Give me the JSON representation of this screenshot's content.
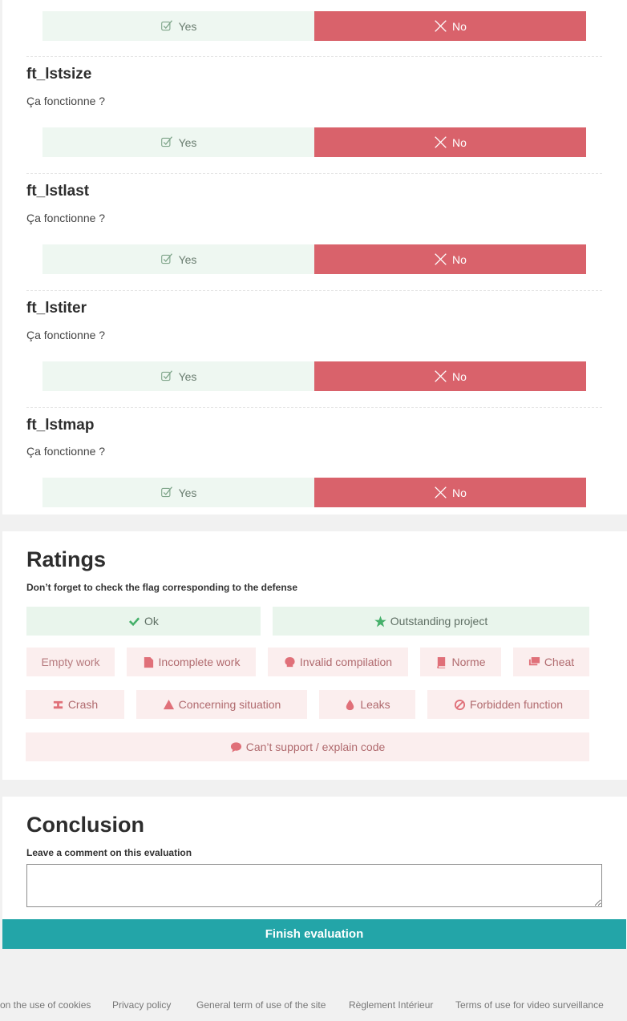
{
  "questions": [
    {
      "title": "",
      "subtitle": "",
      "yes_label": "Yes",
      "no_label": "No"
    },
    {
      "title": "ft_lstsize",
      "subtitle": "Ça fonctionne ?",
      "yes_label": "Yes",
      "no_label": "No"
    },
    {
      "title": "ft_lstlast",
      "subtitle": "Ça fonctionne ?",
      "yes_label": "Yes",
      "no_label": "No"
    },
    {
      "title": "ft_lstiter",
      "subtitle": "Ça fonctionne ?",
      "yes_label": "Yes",
      "no_label": "No"
    },
    {
      "title": "ft_lstmap",
      "subtitle": "Ça fonctionne ?",
      "yes_label": "Yes",
      "no_label": "No"
    }
  ],
  "ratings": {
    "title": "Ratings",
    "note": "Don’t forget to check the flag corresponding to the defense",
    "flags": [
      {
        "label": "Ok",
        "icon": "check-icon"
      },
      {
        "label": "Outstanding project",
        "icon": "star-icon"
      },
      {
        "label": "Empty work",
        "icon": ""
      },
      {
        "label": "Incomplete work",
        "icon": "file-icon"
      },
      {
        "label": "Invalid compilation",
        "icon": "skull-icon"
      },
      {
        "label": "Norme",
        "icon": "book-icon"
      },
      {
        "label": "Cheat",
        "icon": "layers-icon"
      },
      {
        "label": "Crash",
        "icon": "explosion-icon"
      },
      {
        "label": "Concerning situation",
        "icon": "warning-icon"
      },
      {
        "label": "Leaks",
        "icon": "drop-icon"
      },
      {
        "label": "Forbidden function",
        "icon": "ban-icon"
      },
      {
        "label": "Can’t support / explain code",
        "icon": "comment-icon"
      }
    ]
  },
  "conclusion": {
    "title": "Conclusion",
    "note": "Leave a comment on this evaluation",
    "comment_value": "",
    "finish_label": "Finish evaluation"
  },
  "footer": {
    "links": [
      "on the use of cookies",
      "Privacy policy",
      "General term of use of the site",
      "Règlement Intérieur",
      "Terms of use for video surveillance"
    ]
  },
  "colors": {
    "yes_bg": "#eef7f1",
    "no_bg": "#d9626b",
    "positive_flag_bg": "#e9f5ec",
    "negative_flag_bg": "#fbeeee",
    "finish_bg": "#23a5a8"
  }
}
